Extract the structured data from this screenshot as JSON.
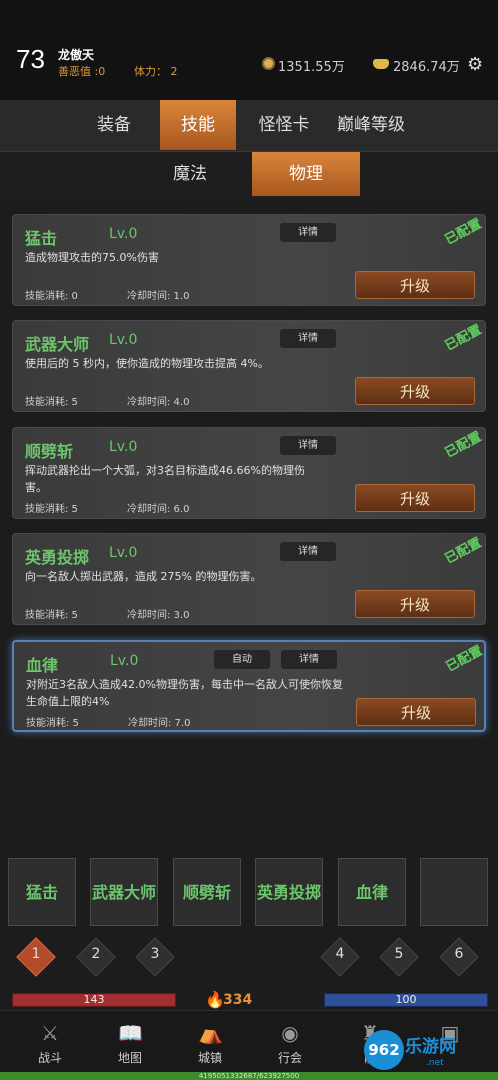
{
  "player": {
    "level": "73",
    "name": "龙傲天",
    "karma": "善恶值 :0",
    "stamina": "体力： 2"
  },
  "currency": {
    "coins": "1351.55万",
    "ingots": "2846.74万"
  },
  "tabs": [
    {
      "label": "装备"
    },
    {
      "label": "技能"
    },
    {
      "label": "怪怪卡"
    },
    {
      "label": "巅峰等级"
    }
  ],
  "subtabs": [
    {
      "label": "魔法"
    },
    {
      "label": "物理"
    }
  ],
  "skills": [
    {
      "name": "猛击",
      "level": "Lv.0",
      "desc": "造成物理攻击的75.0%伤害",
      "cost": "技能消耗:  0",
      "cooldown": "冷却时间:  1.0",
      "detail": "详情",
      "upgrade": "升级",
      "configured": "已配置"
    },
    {
      "name": "武器大师",
      "level": "Lv.0",
      "desc": "使用后的 5 秒内，使你造成的物理攻击提高 4%。",
      "cost": "技能消耗:  5",
      "cooldown": "冷却时间:  4.0",
      "detail": "详情",
      "upgrade": "升级",
      "configured": "已配置"
    },
    {
      "name": "顺劈斩",
      "level": "Lv.0",
      "desc": "挥动武器抡出一个大弧，对3名目标造成46.66%的物理伤害。",
      "cost": "技能消耗:  5",
      "cooldown": "冷却时间:  6.0",
      "detail": "详情",
      "upgrade": "升级",
      "configured": "已配置"
    },
    {
      "name": "英勇投掷",
      "level": "Lv.0",
      "desc": "向一名敌人掷出武器，造成 275% 的物理伤害。",
      "cost": "技能消耗:  5",
      "cooldown": "冷却时间:  3.0",
      "detail": "详情",
      "upgrade": "升级",
      "configured": "已配置"
    },
    {
      "name": "血律",
      "level": "Lv.0",
      "desc": "对附近3名敌人造成42.0%物理伤害，每击中一名敌人可使你恢复生命值上限的4%",
      "cost": "技能消耗:  5",
      "cooldown": "冷却时间:  7.0",
      "detail": "详情",
      "auto": "自动",
      "upgrade": "升级",
      "configured": "已配置"
    }
  ],
  "slots": [
    "猛击",
    "武器大师",
    "顺劈斩",
    "英勇投掷",
    "血律",
    ""
  ],
  "pages": [
    "1",
    "2",
    "3",
    "4",
    "5",
    "6"
  ],
  "stats": {
    "hp": "143",
    "fire": "334",
    "mp": "100"
  },
  "nav": [
    {
      "label": "战斗",
      "icon": "swords-icon"
    },
    {
      "label": "地图",
      "icon": "book-icon"
    },
    {
      "label": "城镇",
      "icon": "tent-icon"
    },
    {
      "label": "行会",
      "icon": "guild-icon"
    },
    {
      "label": "能",
      "icon": "bag-icon"
    },
    {
      "label": "",
      "icon": "shop-icon"
    }
  ],
  "exp": "4195051332687/6239275​00",
  "watermark": {
    "circle": "962",
    "text": "乐游网",
    "url": ".net"
  },
  "colors": {
    "accent": "#d9863a",
    "skill_green": "#6cc56c",
    "hp": "#a22f2f",
    "mp": "#2f4f99"
  }
}
